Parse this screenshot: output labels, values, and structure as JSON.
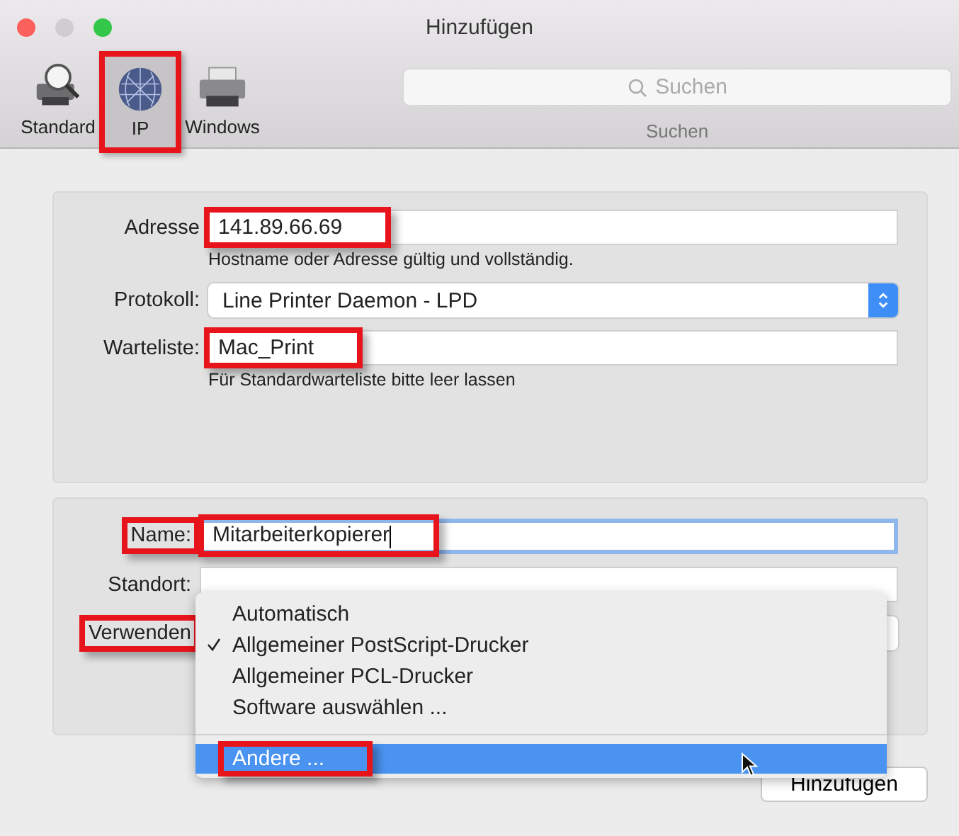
{
  "window": {
    "title": "Hinzufügen"
  },
  "toolbar": [
    {
      "kind": "local",
      "label": "Standard",
      "selected": false,
      "highlighted": false
    },
    {
      "kind": "ip",
      "label": "IP",
      "selected": true,
      "highlighted": true
    },
    {
      "kind": "windows",
      "label": "Windows",
      "selected": false,
      "highlighted": false
    }
  ],
  "search": {
    "placeholder": "Suchen",
    "label": "Suchen"
  },
  "connection": [
    {
      "kind": "field",
      "label": "Adresse",
      "value": "141.89.66.69",
      "hint": "Hostname oder Adresse gültig und vollständig.",
      "highlighted": true
    },
    {
      "kind": "popup",
      "label": "Protokoll:",
      "value": "Line Printer Daemon - LPD",
      "highlighted": false
    },
    {
      "kind": "field",
      "label": "Warteliste:",
      "value": "Mac_Print",
      "hint": "Für Standardwarteliste bitte leer lassen",
      "highlighted": true
    }
  ],
  "details": [
    {
      "kind": "field",
      "label": "Name:",
      "value": "Mitarbeiterkopierer",
      "focused": true,
      "highlighted": true
    },
    {
      "kind": "field",
      "label": "Standort:",
      "focused": false,
      "highlighted": false
    },
    {
      "kind": "popup",
      "label": "Verwenden",
      "highlighted": true
    }
  ],
  "menu": [
    {
      "label": "Automatisch",
      "checked": false,
      "selected": false,
      "highlighted": false
    },
    {
      "label": "Allgemeiner PostScript-Drucker",
      "checked": true,
      "selected": false,
      "highlighted": false
    },
    {
      "label": "Allgemeiner PCL-Drucker",
      "checked": false,
      "selected": false,
      "highlighted": false
    },
    {
      "label": "Software auswählen ...",
      "checked": false,
      "selected": false,
      "highlighted": false
    },
    {
      "label": "Andere ...",
      "checked": false,
      "selected": true,
      "highlighted": true,
      "separator_before": true
    }
  ],
  "buttons": [
    "Hinzufügen"
  ]
}
